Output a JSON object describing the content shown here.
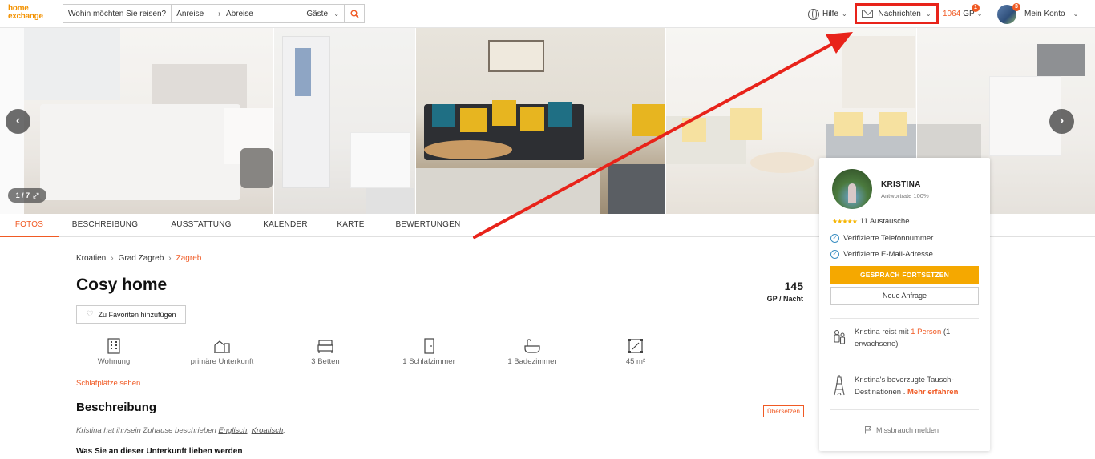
{
  "header": {
    "logo_line1": "home",
    "logo_line2": "exchange",
    "search": {
      "where_placeholder": "Wohin möchten Sie reisen?",
      "arrival": "Anreise",
      "departure": "Abreise",
      "guests": "Gäste",
      "search_icon": "search-icon"
    },
    "help_label": "Hilfe",
    "messages_label": "Nachrichten",
    "gp_value": "1064",
    "gp_label": "GP",
    "gp_badge": "1",
    "account_badge": "3",
    "account_label": "Mein Konto"
  },
  "gallery": {
    "counter": "1 / 7",
    "prev_icon": "chevron-left-icon",
    "next_icon": "chevron-right-icon",
    "expand_icon": "expand-icon"
  },
  "tabs": [
    {
      "label": "FOTOS",
      "active": true
    },
    {
      "label": "BESCHREIBUNG",
      "active": false
    },
    {
      "label": "AUSSTATTUNG",
      "active": false
    },
    {
      "label": "KALENDER",
      "active": false
    },
    {
      "label": "KARTE",
      "active": false
    },
    {
      "label": "BEWERTUNGEN",
      "active": false
    }
  ],
  "breadcrumb": [
    "Kroatien",
    "Grad Zagreb",
    "Zagreb"
  ],
  "listing": {
    "title": "Cosy home",
    "price": "145",
    "price_unit": "GP / Nacht",
    "favorite_label": "Zu Favoriten hinzufügen",
    "features": [
      "Wohnung",
      "primäre Unterkunft",
      "3 Betten",
      "1 Schlafzimmer",
      "1 Badezimmer",
      "45 m²"
    ],
    "sleep_link": "Schlafplätze sehen",
    "description_heading": "Beschreibung",
    "translate_label": "Übersetzen",
    "description_lang_prefix": "Kristina hat ihr/sein Zuhause beschrieben",
    "lang1": "Englisch",
    "lang2": "Kroatisch",
    "love_heading": "Was Sie an dieser Unterkunft lieben werden"
  },
  "host_card": {
    "name": "KRISTINA",
    "response_rate": "Antwortrate 100%",
    "exchanges": "11 Austausche",
    "verified_phone": "Verifizierte Telefonnummer",
    "verified_email": "Verifizierte E-Mail-Adresse",
    "continue_button": "GESPRÄCH FORTSETZEN",
    "new_request_button": "Neue Anfrage",
    "travels_with_prefix": "Kristina reist mit",
    "travels_with_link": "1 Person",
    "travels_with_suffix": "(1 erwachsene)",
    "destinations_text": "Kristina's bevorzugte Tausch-Destinationen .",
    "more_link": "Mehr erfahren",
    "report_label": "Missbrauch melden"
  },
  "colors": {
    "accent": "#f05a24",
    "button_yellow": "#f5a800",
    "annotation_red": "#e8231a",
    "verified_blue": "#3c8fc2"
  }
}
